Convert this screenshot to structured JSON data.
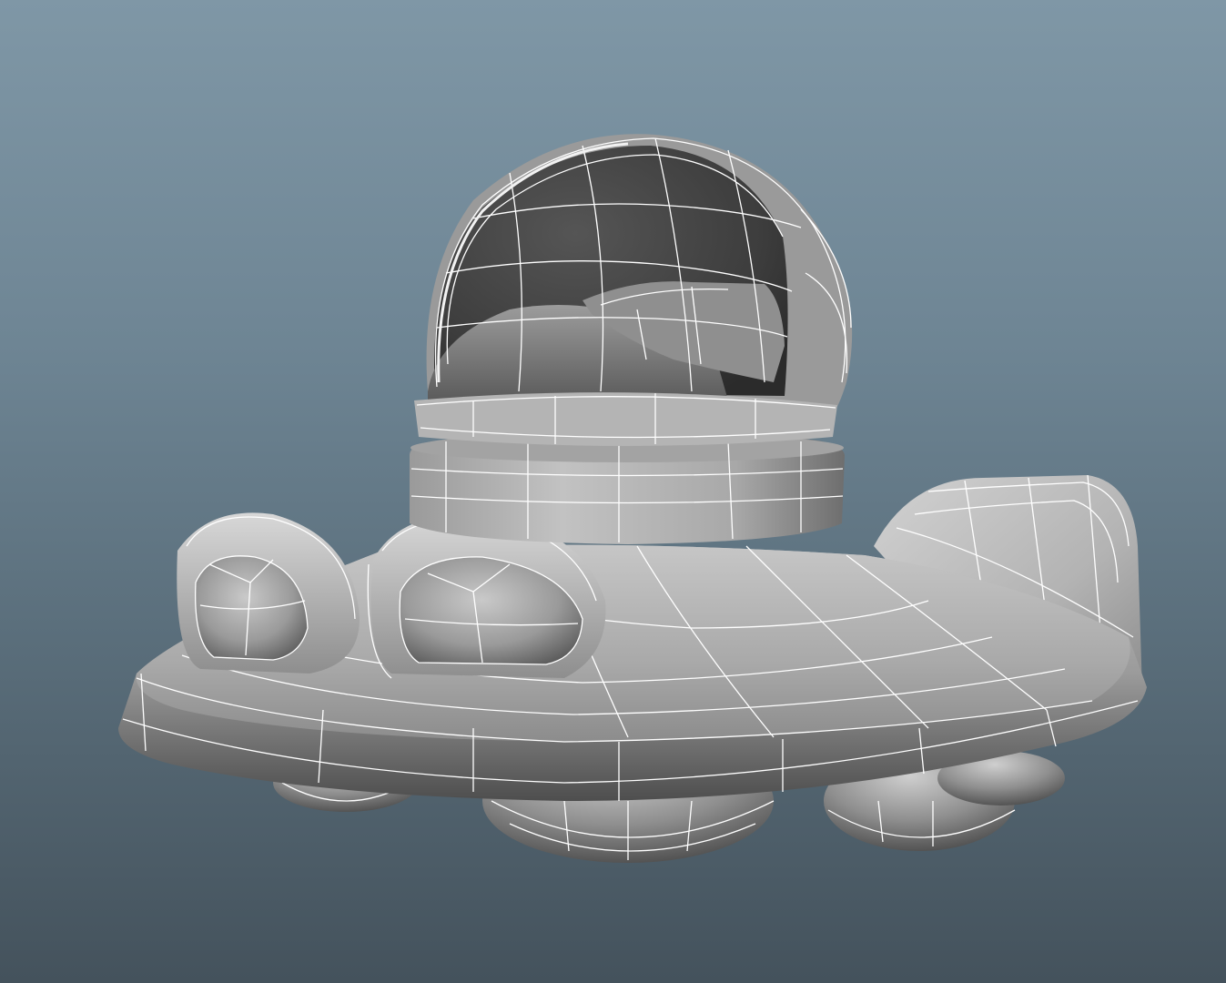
{
  "viewport": {
    "background_top": "#7f97a6",
    "background_bottom": "#44525c",
    "wireframe_color": "#ffffff",
    "shading": "smooth-shaded-with-wireframe-on-shaded"
  },
  "model": {
    "subject": "cartoon-flying-saucer",
    "parts": [
      "glass-dome",
      "dome-collar",
      "saucer-hull",
      "front-port-left",
      "front-port-right",
      "rear-fin",
      "underside-pods"
    ]
  }
}
